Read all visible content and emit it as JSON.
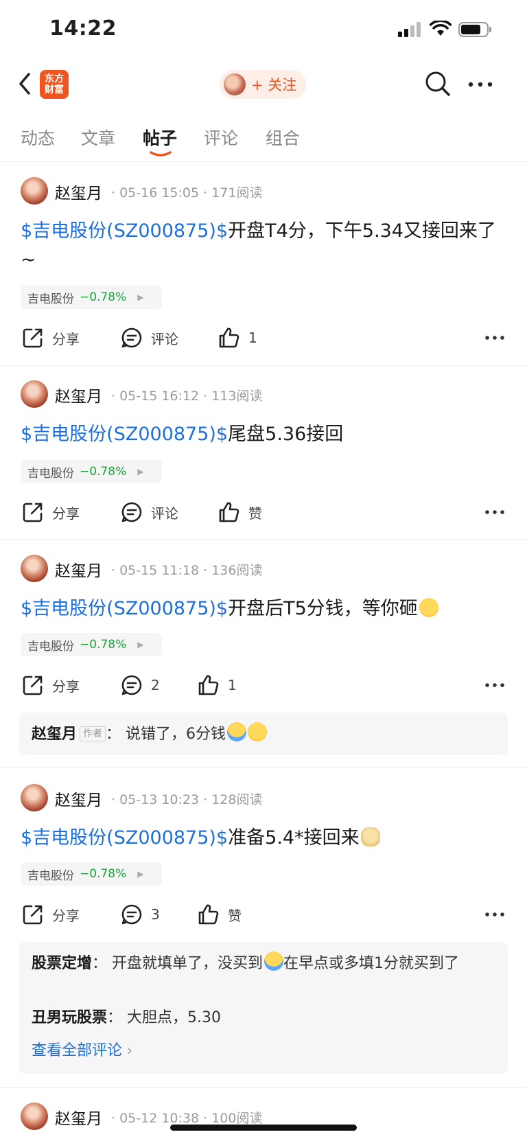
{
  "status_bar": {
    "time": "14:22"
  },
  "header": {
    "logo_line1": "东方",
    "logo_line2": "财富",
    "follow_label": "+ 关注",
    "icons": [
      "back-icon",
      "search-icon",
      "more-icon"
    ],
    "accent_color": "#f0541f"
  },
  "tabs": [
    {
      "label": "动态"
    },
    {
      "label": "文章"
    },
    {
      "label": "帖子",
      "active": true
    },
    {
      "label": "评论"
    },
    {
      "label": "组合"
    }
  ],
  "posts": [
    {
      "author": "赵玺月",
      "meta": "· 05-16 15:05 · 171阅读",
      "stock_tag": "$吉电股份(SZ000875)$",
      "text": "开盘T4分，下午5.34又接回来了~",
      "chip_name": "吉电股份",
      "chip_pct": "−0.78%",
      "share": "分享",
      "comment": "评论",
      "like": "1"
    },
    {
      "author": "赵玺月",
      "meta": "· 05-15 16:12 · 113阅读",
      "stock_tag": "$吉电股份(SZ000875)$",
      "text": "尾盘5.36接回",
      "chip_name": "吉电股份",
      "chip_pct": "−0.78%",
      "share": "分享",
      "comment": "评论",
      "like": "赞"
    },
    {
      "author": "赵玺月",
      "meta": "· 05-15 11:18 · 136阅读",
      "stock_tag": "$吉电股份(SZ000875)$",
      "text": "开盘后T5分钱，等你砸",
      "chip_name": "吉电股份",
      "chip_pct": "−0.78%",
      "share": "分享",
      "comment": "2",
      "like": "1",
      "replies": [
        {
          "who": "赵玺月",
          "tag": "作者",
          "text": "：  说错了，6分钱"
        }
      ]
    },
    {
      "author": "赵玺月",
      "meta": "· 05-13 10:23 · 128阅读",
      "stock_tag": "$吉电股份(SZ000875)$",
      "text": "准备5.4*接回来",
      "chip_name": "吉电股份",
      "chip_pct": "−0.78%",
      "share": "分享",
      "comment": "3",
      "like": "赞",
      "replies": [
        {
          "who": "股票定增",
          "text_a": "：  开盘就填单了，没买到",
          "text_b": "在早点或多填1分就买到了"
        },
        {
          "who": "丑男玩股票",
          "text": "：  大胆点，5.30"
        }
      ],
      "view_all": "查看全部评论"
    },
    {
      "author": "赵玺月",
      "meta": "· 05-12 10:38 · 100阅读"
    }
  ]
}
